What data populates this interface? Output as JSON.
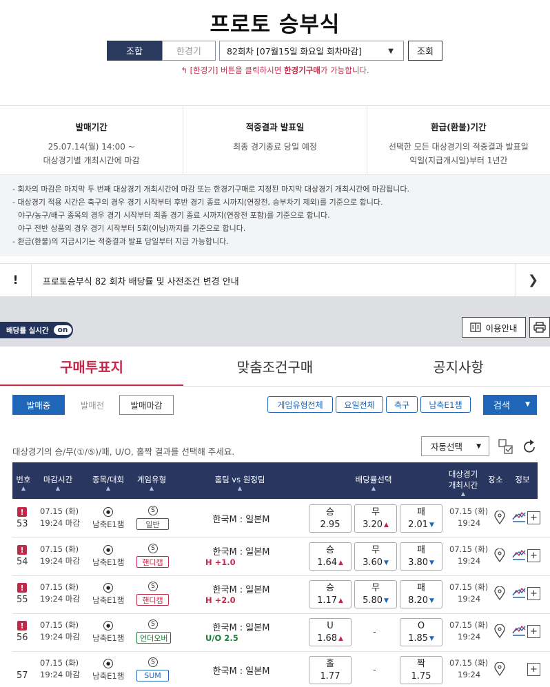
{
  "page_title": "프로토 승부식",
  "mode_tabs": {
    "combo": "조합",
    "single": "한경기"
  },
  "round_select": "82회차 [07월15일 화요일 회차마감]",
  "query_button": "조회",
  "hint": {
    "prefix": "[한경기] 버튼을 클릭하시면 ",
    "strong": "한경기구매",
    "suffix": "가 가능합니다."
  },
  "info": [
    {
      "title": "발매기간",
      "lines": [
        "25.07.14(월) 14:00 ~",
        "대상경기별 개최시간에 마감"
      ]
    },
    {
      "title": "적중결과 발표일",
      "lines": [
        "최종 경기종료 당일 예정"
      ]
    },
    {
      "title": "환급(환불)기간",
      "lines": [
        "선택한 모든 대상경기의 적중결과 발표일",
        "익일(지급개시일)부터 1년간"
      ]
    }
  ],
  "notes": [
    "- 회차의 마감은 마지막 두 번째 대상경기 개최시간에 마감 또는 한경기구매로 지정된 마지막 대상경기 개최시간에 마감됩니다.",
    "- 대상경기 적용 시간은 축구의 경우 경기 시작부터 후반 경기 종료 시까지(연장전, 승부차기 제외)를 기준으로 합니다.",
    "  야구/농구/배구 종목의 경우 경기 시작부터 최종 경기 종료 시까지(연장전 포함)를 기준으로 합니다.",
    "  야구 전반 상품의 경우 경기 시작부터 5회(이닝)까지를 기준으로 합니다.",
    "- 환급(환불)의 지급시기는 적중결과 발표 당일부터 지급 가능합니다."
  ],
  "notice": {
    "mark": "!",
    "text": "프로토승부식 82 회차 배당률 및 사전조건 변경 안내"
  },
  "realtime": {
    "label": "배당률 실시간",
    "state": "on"
  },
  "guide_button": "이용안내",
  "main_tabs": [
    "구매투표지",
    "맞춤조건구매",
    "공지사항"
  ],
  "status_filters": [
    "발매중",
    "발매전",
    "발매마감"
  ],
  "chips": [
    "게임유형전체",
    "요일전체",
    "축구",
    "남축E1챔"
  ],
  "search_button": "검색",
  "instruction": "대상경기의 승/무(①/⑤)/패, U/O, 홀짝 결과를 선택해 주세요.",
  "auto_select": "자동선택",
  "table_headers": {
    "no": "번호",
    "deadline": "마감시간",
    "sport": "종목/대회",
    "type": "게임유형",
    "teams": "홈팀 vs 원정팀",
    "odds": "배당률선택",
    "start_1": "대상경기",
    "start_2": "개최시간",
    "venue": "장소",
    "info": "정보"
  },
  "rows": [
    {
      "warn": "!",
      "no": "53",
      "date": "07.15 (화)",
      "close": "19:24 마감",
      "league": "남축E1챔",
      "s": "S",
      "type": "일반",
      "type_color": "gray",
      "teams": "한국M : 일본M",
      "handicap": "",
      "odds": [
        {
          "label": "승",
          "value": "2.95",
          "dir": ""
        },
        {
          "label": "무",
          "value": "3.20",
          "dir": "up"
        },
        {
          "label": "패",
          "value": "2.01",
          "dir": "dn"
        }
      ],
      "start_date": "07.15 (화)",
      "start_time": "19:24",
      "plus": "+"
    },
    {
      "warn": "!",
      "no": "54",
      "date": "07.15 (화)",
      "close": "19:24 마감",
      "league": "남축E1챔",
      "s": "S",
      "type": "핸디캡",
      "type_color": "red",
      "teams": "한국M : 일본M",
      "handicap": "H +1.0",
      "hcp_color": "red",
      "odds": [
        {
          "label": "승",
          "value": "1.64",
          "dir": "up"
        },
        {
          "label": "무",
          "value": "3.60",
          "dir": "dn"
        },
        {
          "label": "패",
          "value": "3.80",
          "dir": "dn"
        }
      ],
      "start_date": "07.15 (화)",
      "start_time": "19:24",
      "plus": "+"
    },
    {
      "warn": "!",
      "no": "55",
      "date": "07.15 (화)",
      "close": "19:24 마감",
      "league": "남축E1챔",
      "s": "S",
      "type": "핸디캡",
      "type_color": "red",
      "teams": "한국M : 일본M",
      "handicap": "H +2.0",
      "hcp_color": "red",
      "odds": [
        {
          "label": "승",
          "value": "1.17",
          "dir": "up"
        },
        {
          "label": "무",
          "value": "5.80",
          "dir": "dn"
        },
        {
          "label": "패",
          "value": "8.20",
          "dir": "dn"
        }
      ],
      "start_date": "07.15 (화)",
      "start_time": "19:24",
      "plus": "+"
    },
    {
      "warn": "!",
      "no": "56",
      "date": "07.15 (화)",
      "close": "19:24 마감",
      "league": "남축E1챔",
      "s": "S",
      "type": "언더오버",
      "type_color": "green",
      "teams": "한국M : 일본M",
      "handicap": "U/O 2.5",
      "hcp_color": "green",
      "odds": [
        {
          "label": "U",
          "value": "1.68",
          "dir": "up"
        },
        {
          "label": "-",
          "value": "",
          "dir": ""
        },
        {
          "label": "O",
          "value": "1.85",
          "dir": "dn"
        }
      ],
      "start_date": "07.15 (화)",
      "start_time": "19:24",
      "plus": "+"
    },
    {
      "warn": "",
      "no": "57",
      "date": "07.15 (화)",
      "close": "19:24 마감",
      "league": "남축E1챔",
      "s": "S",
      "type": "SUM",
      "type_color": "blue",
      "teams": "한국M : 일본M",
      "handicap": "",
      "odds": [
        {
          "label": "홀",
          "value": "1.77",
          "dir": ""
        },
        {
          "label": "-",
          "value": "",
          "dir": ""
        },
        {
          "label": "짝",
          "value": "1.75",
          "dir": ""
        }
      ],
      "start_date": "07.15 (화)",
      "start_time": "19:24",
      "plus": "+"
    }
  ],
  "colors": {
    "navy": "#293760",
    "accent_red": "#c0294a",
    "blue": "#1f66b8",
    "green": "#1a7a34"
  },
  "icons": [
    "soccer-ball-icon",
    "location-pin-icon",
    "chart-icon",
    "print-icon",
    "book-icon",
    "refresh-icon",
    "checkbox-icon"
  ]
}
